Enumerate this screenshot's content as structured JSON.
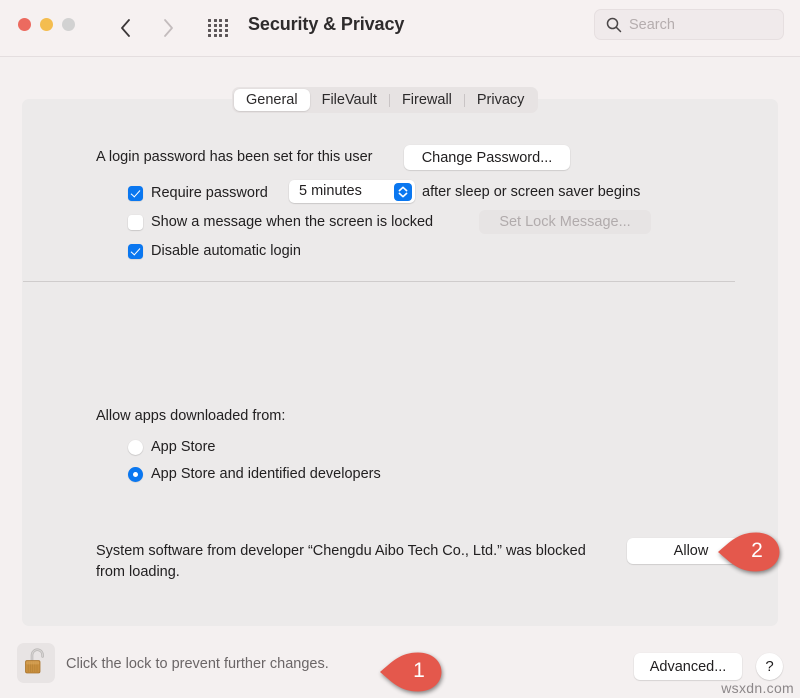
{
  "window": {
    "title": "Security & Privacy",
    "traffic_lights": [
      "close",
      "minimize",
      "zoom"
    ],
    "nav_back_icon": "chevron-left-icon",
    "nav_forward_icon": "chevron-right-icon",
    "grid_icon": "show-all-grid-icon"
  },
  "search": {
    "placeholder": "Search",
    "value": "",
    "icon": "search-icon"
  },
  "tabs": [
    {
      "label": "General",
      "selected": true
    },
    {
      "label": "FileVault",
      "selected": false
    },
    {
      "label": "Firewall",
      "selected": false
    },
    {
      "label": "Privacy",
      "selected": false
    }
  ],
  "general": {
    "login_password_text": "A login password has been set for this user",
    "change_password_label": "Change Password...",
    "require_password": {
      "checked": true,
      "label": "Require password",
      "delay_value": "5 minutes",
      "suffix_label": "after sleep or screen saver begins"
    },
    "show_message": {
      "checked": false,
      "label": "Show a message when the screen is locked",
      "button_label": "Set Lock Message...",
      "button_disabled": true
    },
    "disable_auto_login": {
      "checked": true,
      "label": "Disable automatic login"
    },
    "allow_apps_label": "Allow apps downloaded from:",
    "radios": [
      {
        "label": "App Store",
        "selected": false
      },
      {
        "label": "App Store and identified developers",
        "selected": true
      }
    ],
    "blocked_message": "System software from developer “Chengdu Aibo Tech Co., Ltd.” was blocked from loading.",
    "allow_button_label": "Allow"
  },
  "footer": {
    "lock_icon": "unlocked-padlock-icon",
    "lock_text": "Click the lock to prevent further changes.",
    "advanced_label": "Advanced...",
    "help_label": "?"
  },
  "annotations": [
    {
      "number": "1",
      "target": "lock-text"
    },
    {
      "number": "2",
      "target": "allow-button"
    }
  ],
  "watermark": "wsxdn.com",
  "colors": {
    "accent_blue": "#0a77f0",
    "annotation_red": "#e4584c",
    "window_bg": "#f4f0f0",
    "panel_bg": "#eceaea",
    "lock_gold": "#d9a14a"
  }
}
